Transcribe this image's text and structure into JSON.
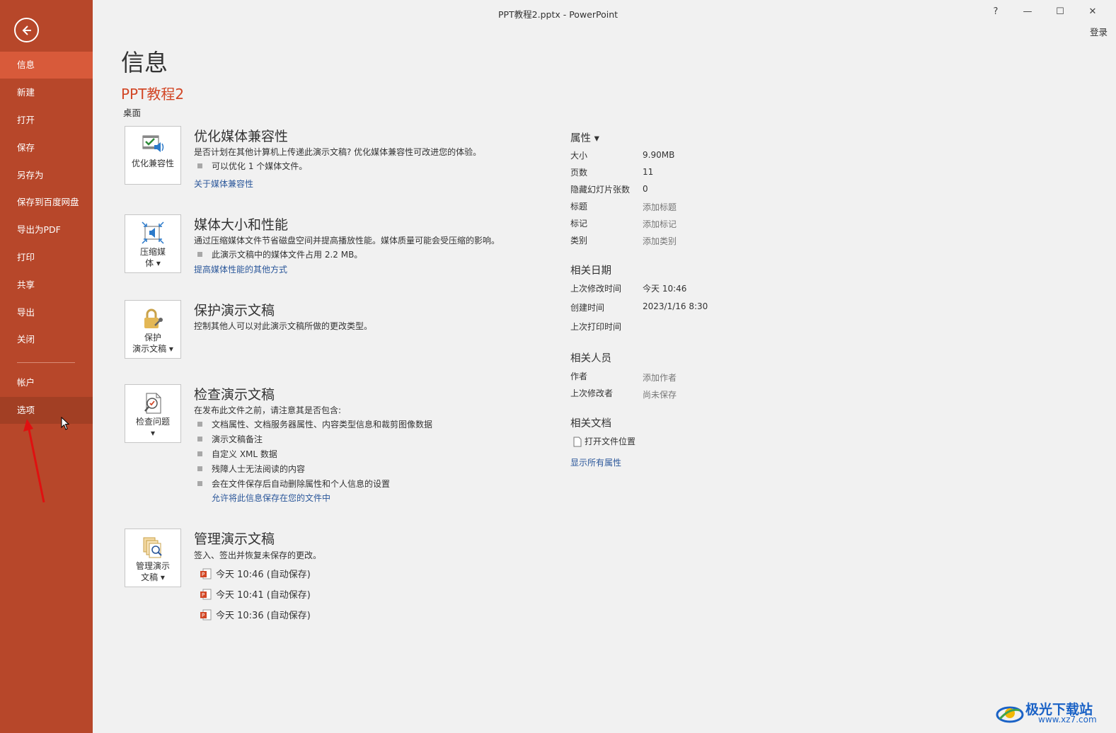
{
  "window": {
    "title": "PPT教程2.pptx - PowerPoint",
    "help": "?",
    "minimize": "—",
    "maximize": "☐",
    "close": "✕",
    "signin": "登录"
  },
  "sidebar": {
    "items": [
      {
        "label": "信息",
        "active": true
      },
      {
        "label": "新建"
      },
      {
        "label": "打开"
      },
      {
        "label": "保存"
      },
      {
        "label": "另存为"
      },
      {
        "label": "保存到百度网盘"
      },
      {
        "label": "导出为PDF"
      },
      {
        "label": "打印"
      },
      {
        "label": "共享"
      },
      {
        "label": "导出"
      },
      {
        "label": "关闭"
      },
      {
        "label": "帐户"
      },
      {
        "label": "选项",
        "hovered": true
      }
    ]
  },
  "main": {
    "title": "信息",
    "doc_name": "PPT教程2",
    "doc_location": "桌面",
    "sections": [
      {
        "button_label": "优化兼容性",
        "title": "优化媒体兼容性",
        "desc": "是否计划在其他计算机上传递此演示文稿? 优化媒体兼容性可改进您的体验。",
        "bullets": [
          "可以优化 1 个媒体文件。"
        ],
        "link": "关于媒体兼容性"
      },
      {
        "button_label_1": "压缩媒",
        "button_label_2": "体 ▾",
        "title": "媒体大小和性能",
        "desc": "通过压缩媒体文件节省磁盘空间并提高播放性能。媒体质量可能会受压缩的影响。",
        "bullets": [
          "此演示文稿中的媒体文件占用 2.2 MB。"
        ],
        "link": "提高媒体性能的其他方式"
      },
      {
        "button_label_1": "保护",
        "button_label_2": "演示文稿 ▾",
        "title": "保护演示文稿",
        "desc": "控制其他人可以对此演示文稿所做的更改类型。"
      },
      {
        "button_label_1": "检查问题",
        "button_label_2": "▾",
        "title": "检查演示文稿",
        "desc": "在发布此文件之前，请注意其是否包含:",
        "bullets": [
          "文档属性、文档服务器属性、内容类型信息和裁剪图像数据",
          "演示文稿备注",
          "自定义 XML 数据",
          "残障人士无法阅读的内容",
          "会在文件保存后自动删除属性和个人信息的设置"
        ],
        "link": "允许将此信息保存在您的文件中"
      },
      {
        "button_label_1": "管理演示",
        "button_label_2": "文稿 ▾",
        "title": "管理演示文稿",
        "desc": "签入、签出并恢复未保存的更改。",
        "versions": [
          "今天 10:46 (自动保存)",
          "今天 10:41 (自动保存)",
          "今天 10:36 (自动保存)"
        ]
      }
    ]
  },
  "properties": {
    "header": "属性 ▾",
    "rows": [
      {
        "label": "大小",
        "value": "9.90MB"
      },
      {
        "label": "页数",
        "value": "11"
      },
      {
        "label": "隐藏幻灯片张数",
        "value": "0"
      },
      {
        "label": "标题",
        "value": "添加标题"
      },
      {
        "label": "标记",
        "value": "添加标记"
      },
      {
        "label": "类别",
        "value": "添加类别"
      }
    ],
    "dates_header": "相关日期",
    "dates": [
      {
        "label": "上次修改时间",
        "value": "今天 10:46"
      },
      {
        "label": "创建时间",
        "value": "2023/1/16 8:30"
      },
      {
        "label": "上次打印时间",
        "value": ""
      }
    ],
    "people_header": "相关人员",
    "people": [
      {
        "label": "作者",
        "value": "添加作者"
      },
      {
        "label": "上次修改者",
        "value": "尚未保存"
      }
    ],
    "docs_header": "相关文档",
    "open_location": "打开文件位置",
    "show_all": "显示所有属性"
  },
  "watermark": {
    "name": "极光下载站",
    "url": "www.xz7.com"
  },
  "colors": {
    "sidebar": "#b7472a",
    "sidebar_active": "#d85a3a",
    "accent": "#d24726",
    "link": "#2b579a"
  }
}
